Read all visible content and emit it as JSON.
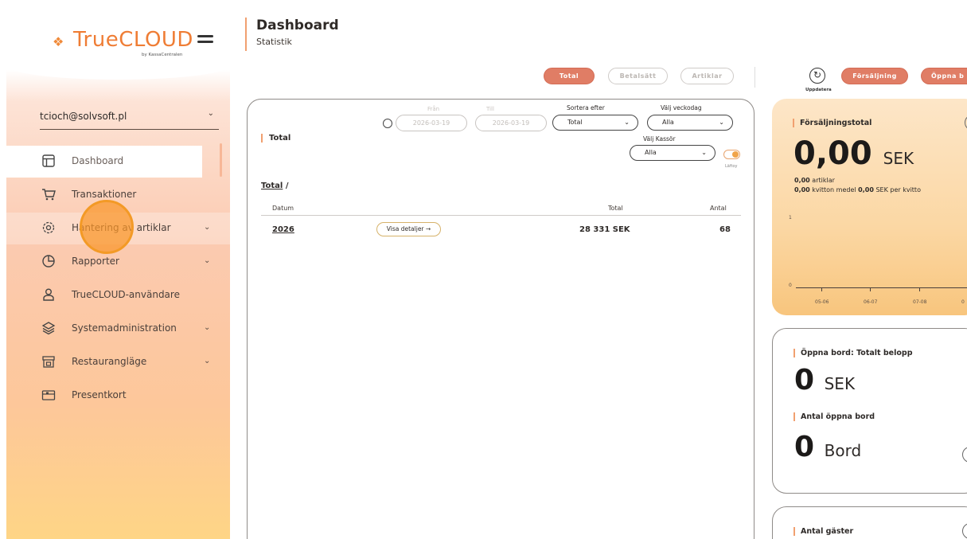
{
  "brand": {
    "logo_text": "TrueCLOUD",
    "logo_sub": "by KassaCentralen"
  },
  "sidebar": {
    "user_email": "tcioch@solvsoft.pl",
    "items": [
      {
        "label": "Dashboard",
        "icon": "layout-icon",
        "active": true
      },
      {
        "label": "Transaktioner",
        "icon": "cart-icon"
      },
      {
        "label": "Hantering av artiklar",
        "icon": "gear-icon",
        "expandable": true
      },
      {
        "label": "Rapporter",
        "icon": "pie-chart-icon",
        "expandable": true
      },
      {
        "label": "TrueCLOUD-användare",
        "icon": "user-icon"
      },
      {
        "label": "Systemadministration",
        "icon": "layers-icon",
        "expandable": true
      },
      {
        "label": "Restaurangläge",
        "icon": "store-icon",
        "expandable": true
      },
      {
        "label": "Presentkort",
        "icon": "gift-card-icon"
      }
    ]
  },
  "header": {
    "title": "Dashboard",
    "subtitle": "Statistik"
  },
  "tabs": {
    "total": "Total",
    "betalsatt": "Betalsätt",
    "artiklar": "Artiklar"
  },
  "right_tabs": {
    "refresh_label": "Uppdatera",
    "forsaljning": "Försäljning",
    "oppna": "Öppna b"
  },
  "panel": {
    "title": "Total",
    "from_label": "Från",
    "to_label": "Till",
    "from_value": "2026-03-19",
    "to_value": "2026-03-19",
    "sort_label": "Sortera efter",
    "sort_value": "Total",
    "weekday_label": "Välj veckodag",
    "weekday_value": "Alla",
    "cashier_label": "Välj Kassör",
    "cashier_value": "Alla",
    "toggle_label": "Läftoy",
    "breadcrumb_link": "Total",
    "breadcrumb_sep": "/",
    "columns": {
      "datum": "Datum",
      "total": "Total",
      "antal": "Antal"
    },
    "rows": [
      {
        "datum": "2026",
        "details": "Visa detaljer →",
        "total": "28 331 SEK",
        "antal": "68"
      }
    ]
  },
  "sales_card": {
    "label": "Försäljningstotal",
    "amount": "0,00",
    "unit": "SEK",
    "articles_value": "0,00",
    "articles_label": "artiklar",
    "receipts_value": "0,00",
    "receipts_label": "kvitton",
    "avg_label": "medel",
    "avg_value": "0,00",
    "avg_suffix": "SEK per kvitto",
    "chart_data": {
      "type": "line",
      "x": [
        "05-06",
        "06-07",
        "07-08",
        "0"
      ],
      "y_ticks": [
        "1",
        "0"
      ],
      "series": [
        {
          "values": [
            0,
            0,
            0,
            0
          ]
        }
      ]
    }
  },
  "open_tables_card": {
    "amount_label": "Öppna bord: Totalt belopp",
    "amount": "0",
    "amount_unit": "SEK",
    "count_label": "Antal öppna bord",
    "count": "0",
    "count_unit": "Bord"
  },
  "guests_card": {
    "label": "Antal gäster"
  }
}
